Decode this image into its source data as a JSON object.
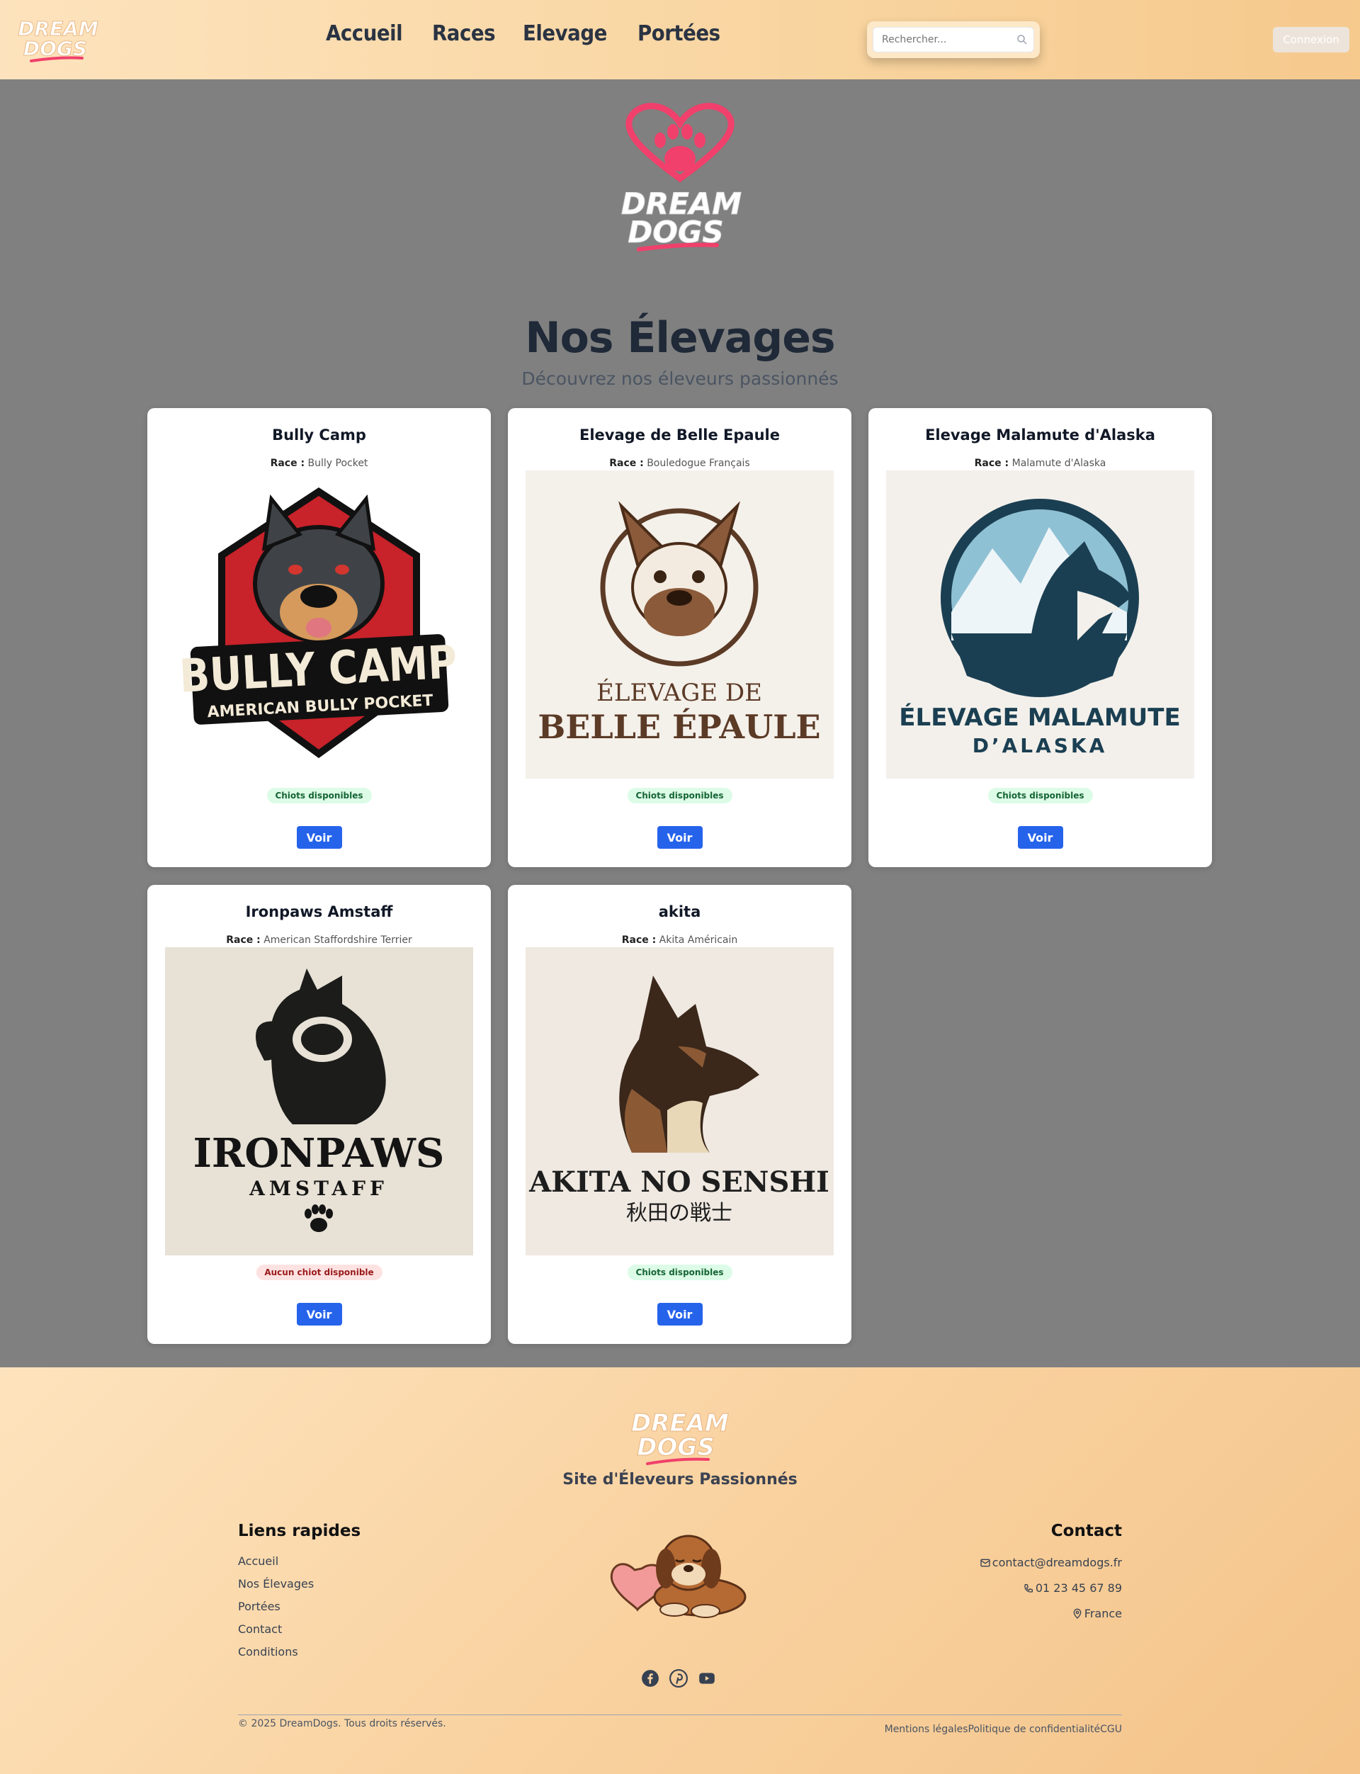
{
  "header": {
    "logo_text": [
      "DREAM",
      "DOGS"
    ],
    "nav": [
      "Accueil",
      "Races",
      "Elevage",
      "Portées"
    ],
    "search_placeholder": "Rechercher...",
    "login_label": "Connexion"
  },
  "main": {
    "title": "Nos Élevages",
    "subtitle": "Découvrez nos éleveurs passionnés",
    "race_label": "Race :",
    "voir_label": "Voir",
    "cards": [
      {
        "title": "Bully Camp",
        "race": "Bully Pocket",
        "status": "Chiots disponibles",
        "available": true,
        "logo_text": [
          "BULLY CAMP",
          "AMERICAN BULLY POCKET"
        ]
      },
      {
        "title": "Elevage de Belle Epaule",
        "race": "Bouledogue Français",
        "status": "Chiots disponibles",
        "available": true,
        "logo_text": [
          "ÉLEVAGE DE",
          "BELLE ÉPAULE"
        ]
      },
      {
        "title": "Elevage Malamute d'Alaska",
        "race": "Malamute d'Alaska",
        "status": "Chiots disponibles",
        "available": true,
        "logo_text": [
          "ÉLEVAGE MALAMUTE",
          "D’ALASKA"
        ]
      },
      {
        "title": "Ironpaws Amstaff",
        "race": "American Staffordshire Terrier",
        "status": "Aucun chiot disponible",
        "available": false,
        "logo_text": [
          "IRONPAWS",
          "AMSTAFF"
        ]
      },
      {
        "title": "akita",
        "race": "Akita Américain",
        "status": "Chiots disponibles",
        "available": true,
        "logo_text": [
          "AKITA NO SENSHI",
          "秋田の戦士"
        ]
      }
    ]
  },
  "footer": {
    "tagline": "Site d'Éleveurs Passionnés",
    "quick_links_title": "Liens rapides",
    "quick_links": [
      "Accueil",
      "Nos Élevages",
      "Portées",
      "Contact",
      "Conditions"
    ],
    "contact_title": "Contact",
    "email": "contact@dreamdogs.fr",
    "phone": "01 23 45 67 89",
    "location": "France",
    "social_icons": [
      "facebook-icon",
      "pinterest-icon",
      "youtube-icon"
    ],
    "copyright": "© 2025 DreamDogs. Tous droits réservés.",
    "legal": [
      "Mentions légales",
      "Politique de confidentialité",
      "CGU"
    ]
  },
  "colors": {
    "accent_blue": "#2563eb",
    "brand_pink": "#f0406b",
    "header_bg": "#f9d7a4",
    "main_bg": "#808080"
  }
}
